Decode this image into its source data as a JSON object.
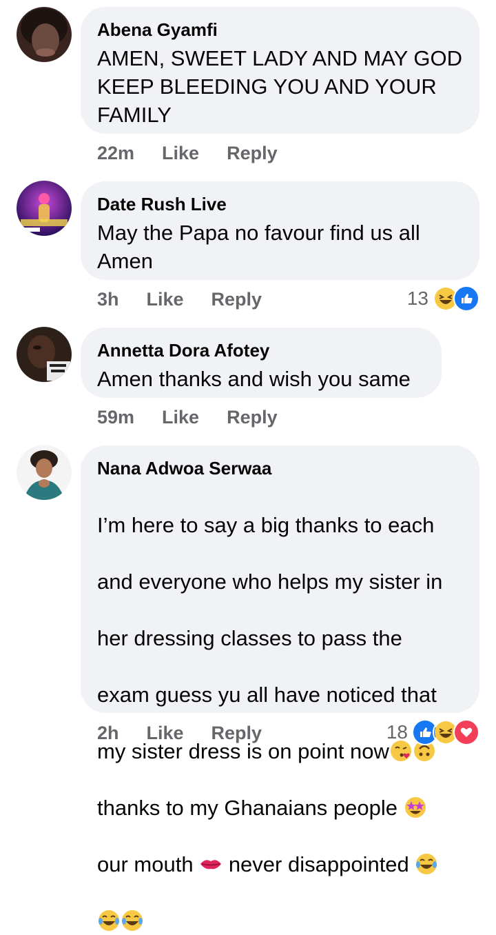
{
  "comments": [
    {
      "name": "Abena Gyamfi",
      "text": "AMEN, SWEET LADY AND MAY GOD\nKEEP BLEEDING YOU AND YOUR\nFAMILY",
      "time": "22m",
      "like": "Like",
      "reply": "Reply"
    },
    {
      "name": "Date Rush Live",
      "text": "May the Papa no favour find us all\nAmen",
      "time": "3h",
      "like": "Like",
      "reply": "Reply",
      "reaction_count": "13",
      "reactions": [
        "laughing-emoji",
        "like-icon"
      ]
    },
    {
      "name": "Annetta Dora Afotey",
      "text": "Amen thanks and wish you same",
      "time": "59m",
      "like": "Like",
      "reply": "Reply"
    },
    {
      "name": "Nana Adwoa Serwaa",
      "text_lines": [
        "I’m here to say a big thanks to each",
        "and everyone who helps my sister in",
        "her dressing classes to pass the",
        "exam guess yu all have noticed that",
        "my sister dress is on point now",
        "thanks to my Ghanaians people ",
        "our mouth ",
        " never disappointed "
      ],
      "time": "2h",
      "like": "Like",
      "reply": "Reply",
      "reaction_count": "18",
      "reactions": [
        "like-icon",
        "laughing-emoji",
        "love-icon"
      ]
    }
  ],
  "colors": {
    "bubble": "#f0f2f5",
    "meta_text": "#65676b",
    "like_blue": "#1877f2",
    "love_red": "#f33e58",
    "emoji_yellow": "#f7c844"
  }
}
